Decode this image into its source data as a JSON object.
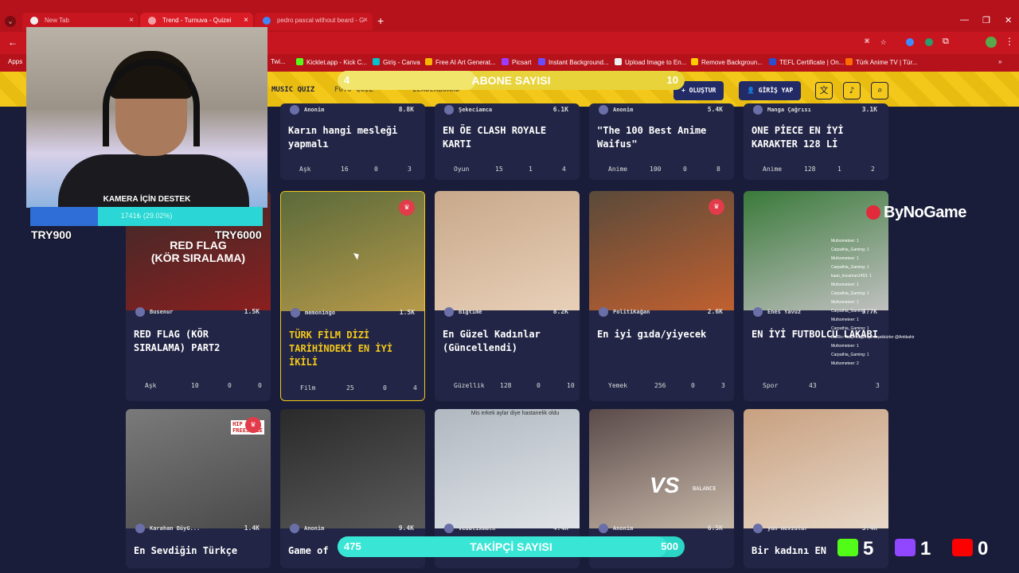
{
  "browser": {
    "tabs": [
      {
        "label": "New Tab",
        "active": false
      },
      {
        "label": "Trend - Turnuva - Quizei",
        "active": true
      },
      {
        "label": "pedro pascal without beard - G",
        "active": false
      }
    ],
    "bookmarks": [
      "Apps",
      "Twi...",
      "Kicklet.app - Kick C...",
      "Giriş - Canva",
      "Free AI Art Generat...",
      "Picsart",
      "Instant Background...",
      "Upload Image to En...",
      "Remove Backgroun...",
      "TEFL Certificate | On...",
      "Türk Anime TV | Tür..."
    ]
  },
  "header": {
    "nav": [
      "MUSIC QUIZ",
      "FOTO QUIZ",
      "LEADERBOARD"
    ],
    "create_label": "OLUŞTUR",
    "login_label": "GİRİŞ YAP",
    "icons": [
      "translate-icon",
      "bell-icon",
      "search-icon"
    ]
  },
  "overlay": {
    "abone": {
      "label": "ABONE SAYISI",
      "current": "4",
      "goal": "10",
      "progress": 0.4
    },
    "takipci": {
      "label": "TAKİPÇİ SAYISI",
      "current": "475",
      "goal": "500",
      "progress": 0.95
    },
    "kamera": {
      "label": "KAMERA İÇİN DESTEK",
      "amount": "1741₺ (29.02%)",
      "progress": 0.29,
      "left": "TRY900",
      "right": "TRY6000"
    },
    "sponsor": "ByNoGame",
    "social": [
      {
        "platform": "kick",
        "count": "5",
        "color": "#53fc18"
      },
      {
        "platform": "twitch",
        "count": "1",
        "color": "#9146ff"
      },
      {
        "platform": "youtube",
        "count": "0",
        "color": "#ff0000"
      }
    ],
    "chat": [
      "Mufsometeer: 1",
      "Carpathia_Gaming: 1",
      "Mufsometeer: 1",
      "Carpathia_Gaming: 1",
      "kaan_kocaman1453: 1",
      "Mufsometeer: 1",
      "Carpathia_Gaming: 1",
      "Mufsometeer: 1",
      "Carpathia_Gaming: 1",
      "Mufsometeer: 1",
      "Carpathia_Gaming: 1",
      "BotRix: Takip ettiğin için teşekkürler @Antikahir",
      "Mufsometeer: 1",
      "Carpathia_Gaming: 1",
      "Mufsometeer: 2"
    ]
  },
  "cards_row1": [
    {
      "author": "Anonim",
      "plays": "8.8K",
      "title": "Karın hangi mesleği yapmalı",
      "category": "Aşk",
      "questions": "16",
      "comments": "0",
      "likes": "3"
    },
    {
      "author": "Şekeciamca",
      "plays": "6.1K",
      "title": "EN ÖE CLASH ROYALE KARTI",
      "category": "Oyun",
      "questions": "15",
      "comments": "1",
      "likes": "4"
    },
    {
      "author": "Anonim",
      "plays": "5.4K",
      "title": "\"The 100 Best Anime Waifus\"",
      "category": "Anime",
      "questions": "100",
      "comments": "0",
      "likes": "8"
    },
    {
      "author": "Manga Çağrısı",
      "plays": "3.1K",
      "title": "ONE PİECE EN İYİ KARAKTER 128 Lİ",
      "category": "Anime",
      "questions": "128",
      "comments": "1",
      "likes": "2"
    }
  ],
  "cards_row2": [
    {
      "author": "Busenur",
      "plays": "1.5K",
      "title": "RED FLAG (KÖR SIRALAMA) PART2",
      "thumb_text": "RED FLAG\n(KÖR SIRALAMA)",
      "category": "Aşk",
      "questions": "10",
      "comments": "0",
      "likes": "0"
    },
    {
      "author": "memoningo",
      "plays": "1.5K",
      "title": "TÜRK FİLM DİZİ TARİHİNDEKİ EN İYİ İKİLİ",
      "category": "Film",
      "questions": "25",
      "comments": "0",
      "likes": "4"
    },
    {
      "author": "Bigtime",
      "plays": "8.2K",
      "title": "En Güzel Kadınlar (Güncellendi)",
      "category": "Güzellik",
      "questions": "128",
      "comments": "0",
      "likes": "10"
    },
    {
      "author": "PolitiKağan",
      "plays": "2.6K",
      "title": "En iyi gıda/yiyecek",
      "category": "Yemek",
      "questions": "256",
      "comments": "0",
      "likes": "3"
    },
    {
      "author": "Enes Yavuz",
      "plays": "3.7K",
      "title": "EN İYİ FUTBOLCU LAKABI",
      "category": "Spor",
      "questions": "43",
      "comments": "",
      "likes": "3"
    }
  ],
  "cards_row3": [
    {
      "author": "Karahan BüyG...",
      "plays": "1.4K",
      "title": "En Sevdiğin Türkçe"
    },
    {
      "author": "Anonim",
      "plays": "9.4K",
      "title": "Game of"
    },
    {
      "author": "vedalixmath",
      "plays": "4.4K",
      "title": ""
    },
    {
      "author": "Anonim",
      "plays": "6.5K",
      "title": ""
    },
    {
      "author": "yan mevzular",
      "plays": "3.4K",
      "title": "Bir kadını EN"
    }
  ],
  "thumb_texts": {
    "hospital": "Mis erkek aylar diye hastanelik oldu",
    "vs": "VS",
    "hip": "HIP\nFREESTYLE",
    "balance": "BALANCE"
  }
}
